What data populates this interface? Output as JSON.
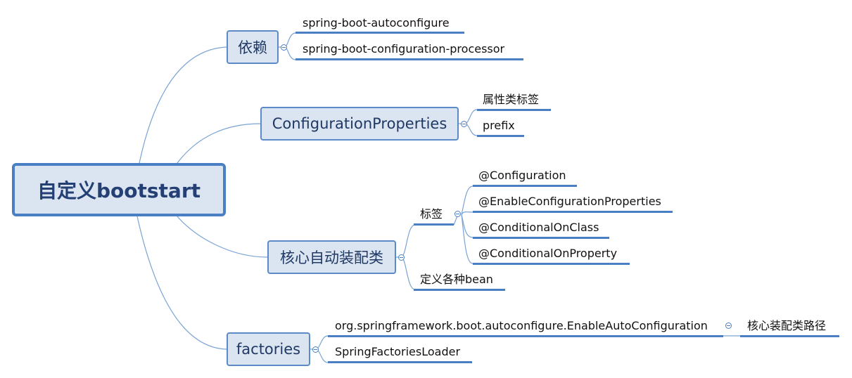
{
  "root": {
    "label": "自定义bootstart"
  },
  "branches": {
    "dependency": {
      "label": "依赖",
      "children": [
        "spring-boot-autoconfigure",
        "spring-boot-configuration-processor"
      ]
    },
    "config_properties": {
      "label": "ConfigurationProperties",
      "children": [
        "属性类标签",
        "prefix"
      ]
    },
    "core_autoconfig": {
      "label": "核心自动装配类",
      "annotations": {
        "label": "标签",
        "children": [
          "@Configuration",
          "@EnableConfigurationProperties",
          "@ConditionalOnClass",
          "@ConditionalOnProperty"
        ]
      },
      "beans": "定义各种bean"
    },
    "factories": {
      "label": "factories",
      "enable_auto": {
        "label": "org.springframework.boot.autoconfigure.EnableAutoConfiguration",
        "child": "核心装配类路径"
      },
      "loader": "SpringFactoriesLoader"
    }
  }
}
